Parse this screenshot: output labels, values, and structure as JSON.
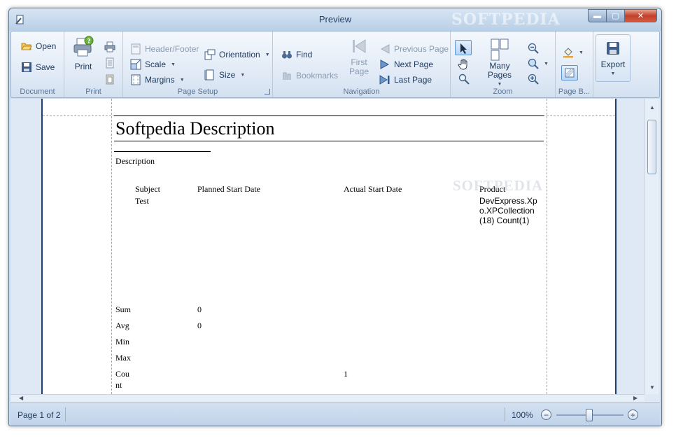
{
  "window": {
    "title": "Preview",
    "watermark": "SOFTPEDIA"
  },
  "ribbon": {
    "document": {
      "label": "Document",
      "open": "Open",
      "save": "Save"
    },
    "print": {
      "label": "Print",
      "print": "Print"
    },
    "page_setup": {
      "label": "Page Setup",
      "header_footer": "Header/Footer",
      "scale": "Scale",
      "margins": "Margins",
      "orientation": "Orientation",
      "size": "Size"
    },
    "navigation": {
      "label": "Navigation",
      "find": "Find",
      "bookmarks": "Bookmarks",
      "first_page_1": "First",
      "first_page_2": "Page",
      "previous_page": "Previous Page",
      "next_page": "Next Page",
      "last_page": "Last Page"
    },
    "zoom": {
      "label": "Zoom",
      "many_pages": "Many Pages"
    },
    "page_background": {
      "label": "Page B..."
    },
    "export": {
      "label": "Export"
    }
  },
  "report": {
    "title": "Softpedia Description",
    "section": "Description",
    "columns": [
      "Subject",
      "Planned Start Date",
      "Actual Start Date",
      "Product"
    ],
    "row": {
      "subject": "Test",
      "product_line1": "DevExpress.Xp",
      "product_line2": "o.XPCollection",
      "product_line3": "(18) Count(1)"
    },
    "watermark": "SOFTPEDIA",
    "summary": [
      {
        "label": "Sum",
        "planned": "0",
        "actual": ""
      },
      {
        "label": "Avg",
        "planned": "0",
        "actual": ""
      },
      {
        "label": "Min",
        "planned": "",
        "actual": ""
      },
      {
        "label": "Max",
        "planned": "",
        "actual": ""
      },
      {
        "label_line1": "Cou",
        "label_line2": "nt",
        "planned": "",
        "actual": "1"
      }
    ]
  },
  "status": {
    "page": "Page 1 of 2",
    "zoom": "100%"
  },
  "colors": {
    "accent": "#1e395b",
    "ribbon": "#dfe9f5",
    "page_border": "#1f3f70"
  }
}
